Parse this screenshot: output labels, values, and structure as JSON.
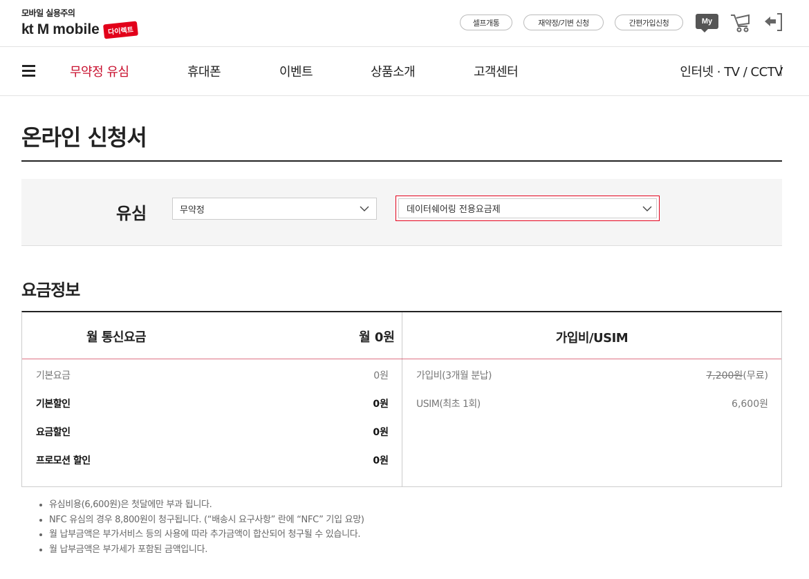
{
  "header": {
    "tagline": "모바일 실용주의",
    "logo": {
      "kt": "kt",
      "m": "M",
      "mobile": "mobile",
      "direct": "다이렉트"
    },
    "pills": [
      "셀프개통",
      "재약정/기변 신청",
      "간편가입신청"
    ],
    "my_label": "My",
    "icons": [
      "cart-icon",
      "logout-icon"
    ]
  },
  "nav": {
    "items": [
      "무약정 유심",
      "휴대폰",
      "이벤트",
      "상품소개",
      "고객센터"
    ],
    "active_index": 0,
    "right_link": "인터넷 · TV / CCTV"
  },
  "page": {
    "title": "온라인 신청서"
  },
  "usim": {
    "label": "유심",
    "select_type": "무약정",
    "select_plan": "데이터쉐어링 전용요금제"
  },
  "fee": {
    "section_title": "요금정보",
    "monthly_title": "월 통신요금",
    "monthly_total": "월 0원",
    "join_title": "가입비/USIM",
    "monthly_rows": [
      {
        "label": "기본요금",
        "value": "0원"
      },
      {
        "label": "기본할인",
        "value": "0원"
      },
      {
        "label": "요금할인",
        "value": "0원"
      },
      {
        "label": "프로모션 할인",
        "value": "0원"
      }
    ],
    "join_rows": [
      {
        "label": "가입비(3개월 분납)",
        "value_strike": "7,200원",
        "value_note": "(무료)"
      },
      {
        "label": "USIM(최초 1회)",
        "value": "6,600원"
      }
    ]
  },
  "notes": [
    "유심비용(6,600원)은 첫달에만 부과 됩니다.",
    "NFC 유심의 경우 8,800원이 청구됩니다. (“배송시 요구사항” 란에 “NFC” 기입 요망)",
    "월 납부금액은 부가서비스 등의 사용에 따라 추가금액이 합산되어 청구될 수 있습니다.",
    "월 납부금액은 부가세가 포함된 금액입니다."
  ],
  "colors": {
    "accent": "#c8102e",
    "brand_red": "#e2001a"
  }
}
